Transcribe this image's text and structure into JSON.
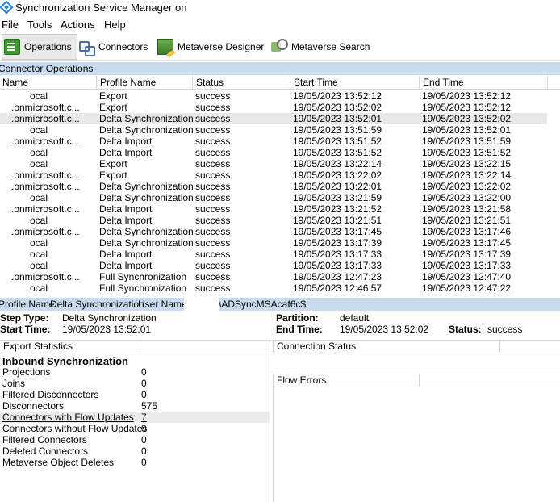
{
  "window": {
    "title": "Synchronization Service Manager on"
  },
  "menu": [
    "File",
    "Tools",
    "Actions",
    "Help"
  ],
  "toolbar": {
    "operations": "Operations",
    "connectors": "Connectors",
    "metaverse_designer": "Metaverse Designer",
    "metaverse_search": "Metaverse Search"
  },
  "connector_operations": {
    "title": "Connector Operations",
    "columns": [
      "Name",
      "Profile Name",
      "Status",
      "Start Time",
      "End Time"
    ],
    "rows": [
      [
        "ocal",
        "Export",
        "success",
        "19/05/2023 13:52:12",
        "19/05/2023 13:52:12"
      ],
      [
        ".onmicrosoft.c...",
        "Export",
        "success",
        "19/05/2023 13:52:02",
        "19/05/2023 13:52:12"
      ],
      [
        ".onmicrosoft.c...",
        "Delta Synchronization",
        "success",
        "19/05/2023 13:52:01",
        "19/05/2023 13:52:02"
      ],
      [
        "ocal",
        "Delta Synchronization",
        "success",
        "19/05/2023 13:51:59",
        "19/05/2023 13:52:01"
      ],
      [
        ".onmicrosoft.c...",
        "Delta Import",
        "success",
        "19/05/2023 13:51:52",
        "19/05/2023 13:51:59"
      ],
      [
        "ocal",
        "Delta Import",
        "success",
        "19/05/2023 13:51:52",
        "19/05/2023 13:51:52"
      ],
      [
        "ocal",
        "Export",
        "success",
        "19/05/2023 13:22:14",
        "19/05/2023 13:22:15"
      ],
      [
        ".onmicrosoft.c...",
        "Export",
        "success",
        "19/05/2023 13:22:02",
        "19/05/2023 13:22:14"
      ],
      [
        ".onmicrosoft.c...",
        "Delta Synchronization",
        "success",
        "19/05/2023 13:22:01",
        "19/05/2023 13:22:02"
      ],
      [
        "ocal",
        "Delta Synchronization",
        "success",
        "19/05/2023 13:21:59",
        "19/05/2023 13:22:00"
      ],
      [
        ".onmicrosoft.c...",
        "Delta Import",
        "success",
        "19/05/2023 13:21:52",
        "19/05/2023 13:21:58"
      ],
      [
        "ocal",
        "Delta Import",
        "success",
        "19/05/2023 13:21:51",
        "19/05/2023 13:21:51"
      ],
      [
        ".onmicrosoft.c...",
        "Delta Synchronization",
        "success",
        "19/05/2023 13:17:45",
        "19/05/2023 13:17:46"
      ],
      [
        "ocal",
        "Delta Synchronization",
        "success",
        "19/05/2023 13:17:39",
        "19/05/2023 13:17:45"
      ],
      [
        "ocal",
        "Delta Import",
        "success",
        "19/05/2023 13:17:33",
        "19/05/2023 13:17:39"
      ],
      [
        "ocal",
        "Delta Import",
        "success",
        "19/05/2023 13:17:33",
        "19/05/2023 13:17:33"
      ],
      [
        ".onmicrosoft.c...",
        "Full Synchronization",
        "success",
        "19/05/2023 12:47:23",
        "19/05/2023 12:47:40"
      ],
      [
        "ocal",
        "Full Synchronization",
        "success",
        "19/05/2023 12:46:57",
        "19/05/2023 12:47:22"
      ]
    ],
    "selected_index": 2
  },
  "details": {
    "profile_name_label": "Profile Name:",
    "profile_name": "Delta Synchronization",
    "user_name_label": "User Name:",
    "user_name": "\\ADSyncMSAcaf6c$",
    "step_type_label": "Step Type:",
    "step_type": "Delta Synchronization",
    "start_time_label": "Start Time:",
    "start_time": "19/05/2023 13:52:01",
    "partition_label": "Partition:",
    "partition": "default",
    "end_time_label": "End Time:",
    "end_time": "19/05/2023 13:52:02",
    "status_label": "Status:",
    "status": "success"
  },
  "export_statistics": {
    "header": "Export Statistics",
    "section": "Inbound Synchronization",
    "items": [
      {
        "label": "Projections",
        "value": "0"
      },
      {
        "label": "Joins",
        "value": "0"
      },
      {
        "label": "Filtered Disconnectors",
        "value": "0"
      },
      {
        "label": "Disconnectors",
        "value": "575"
      },
      {
        "label": "Connectors with Flow Updates",
        "value": "7"
      },
      {
        "label": "Connectors without Flow Updates",
        "value": "0"
      },
      {
        "label": "Filtered Connectors",
        "value": "0"
      },
      {
        "label": "Deleted Connectors",
        "value": "0"
      },
      {
        "label": "Metaverse Object Deletes",
        "value": "0"
      }
    ]
  },
  "connection_status": {
    "header": "Connection Status"
  },
  "flow_errors": {
    "header": "Flow Errors"
  }
}
